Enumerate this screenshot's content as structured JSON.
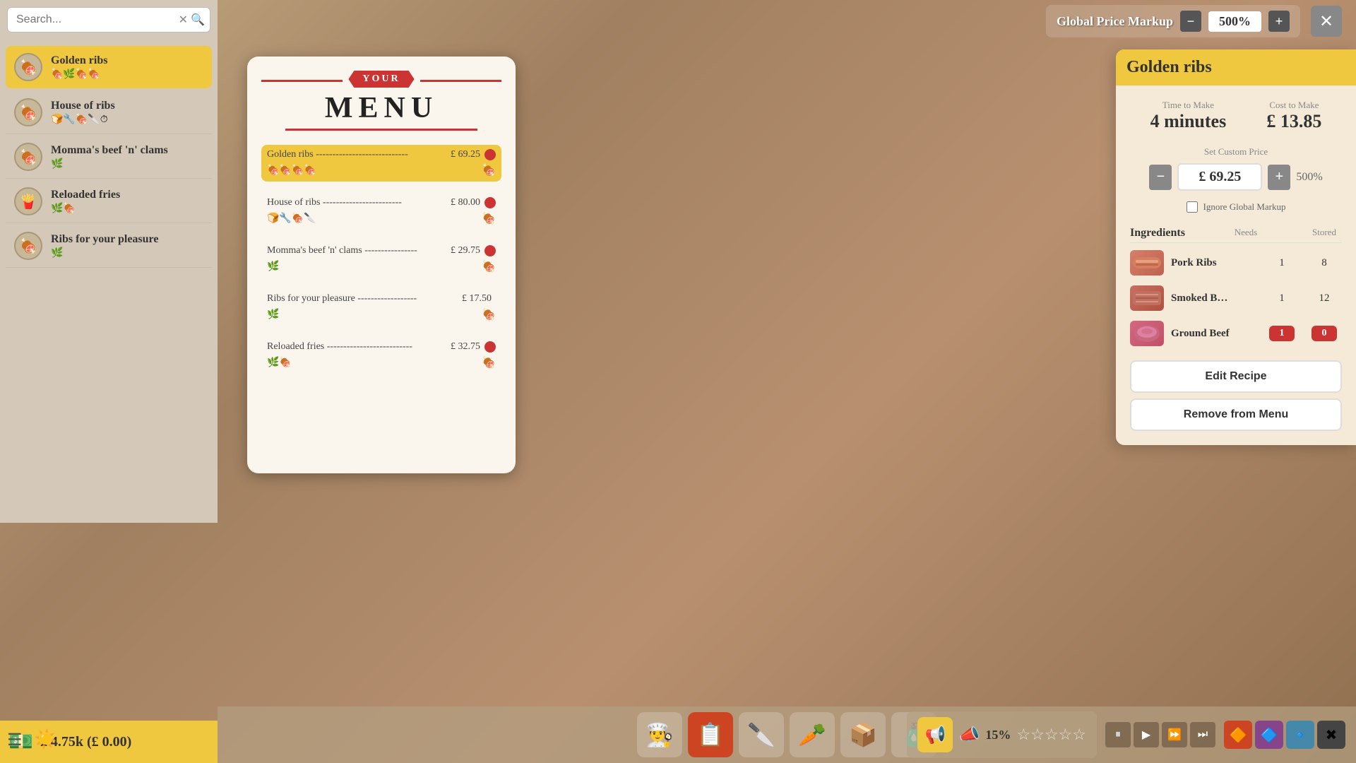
{
  "topBar": {
    "globalPriceLabel": "Global Price Markup",
    "markupValue": "500%",
    "decreaseLabel": "−",
    "increaseLabel": "+",
    "closeLabel": "✕"
  },
  "sidebar": {
    "searchPlaceholder": "Search...",
    "items": [
      {
        "name": "Golden ribs",
        "tags": "🍖🌿🍖🍖",
        "selected": true
      },
      {
        "name": "House of ribs",
        "tags": "🍞🔧🍖🔪⏱"
      },
      {
        "name": "Momma's beef 'n' clams",
        "tags": "🌿"
      },
      {
        "name": "Reloaded fries",
        "tags": "🌿🍖"
      },
      {
        "name": "Ribs for your pleasure",
        "tags": "🌿"
      }
    ]
  },
  "moneyBar": {
    "amount": "£ 4.75k (£ 0.00)"
  },
  "menuCard": {
    "yourLabel": "YOUR",
    "menuTitle": "MENU",
    "entries": [
      {
        "name": "Golden ribs",
        "dots": "----------------------------",
        "price": "£ 69.25",
        "highlighted": true,
        "leftIcons": "🍖🍖🍖🍖",
        "rightIcon": "🍖"
      },
      {
        "name": "House of ribs",
        "dots": "------------------------",
        "price": "£ 80.00",
        "highlighted": false,
        "leftIcons": "🍞🔧🍖🔪",
        "rightIcon": "🍖"
      },
      {
        "name": "Momma's beef 'n' clams",
        "dots": "----------------",
        "price": "£ 29.75",
        "highlighted": false,
        "leftIcons": "🌿",
        "rightIcon": "🍖"
      },
      {
        "name": "Ribs for your pleasure",
        "dots": "------------------",
        "price": "£ 17.50",
        "highlighted": false,
        "leftIcons": "🌿",
        "rightIcon": "🍖"
      },
      {
        "name": "Reloaded fries",
        "dots": "--------------------------",
        "price": "£ 32.75",
        "highlighted": false,
        "leftIcons": "🌿🍖",
        "rightIcon": "🍖"
      }
    ]
  },
  "rightPanel": {
    "title": "Golden ribs",
    "timeTomakeLabel": "Time to Make",
    "timeTomakeValue": "4 minutes",
    "costToMakeLabel": "Cost to Make",
    "costToMakeValue": "£ 13.85",
    "customPriceLabel": "Set Custom Price",
    "priceValue": "£ 69.25",
    "pricePercent": "500%",
    "decreaseLabel": "−",
    "increaseLabel": "+",
    "ignoreMarkupLabel": "Ignore Global Markup",
    "ingredientsTitle": "Ingredients",
    "needsLabel": "Needs",
    "storedLabel": "Stored",
    "ingredients": [
      {
        "name": "Pork Ribs",
        "needs": "1",
        "stored": "8",
        "storedType": "normal"
      },
      {
        "name": "Smoked B…",
        "needs": "1",
        "stored": "12",
        "storedType": "normal"
      },
      {
        "name": "Ground Beef",
        "needs": "1",
        "stored": "0",
        "storedType": "red",
        "needsBadge": true
      }
    ],
    "editRecipeLabel": "Edit Recipe",
    "removeFromMenuLabel": "Remove from Menu"
  },
  "bottomToolbar": {
    "buttons": [
      "👨‍🍳",
      "📋",
      "🔪",
      "🥕",
      "📦",
      "🧴"
    ]
  },
  "ratingBar": {
    "percent": "15%",
    "stars": "☆☆☆☆☆"
  },
  "playback": {
    "pause": "⏸",
    "play": "▶",
    "fast": "⏩",
    "faster": "⏭"
  }
}
